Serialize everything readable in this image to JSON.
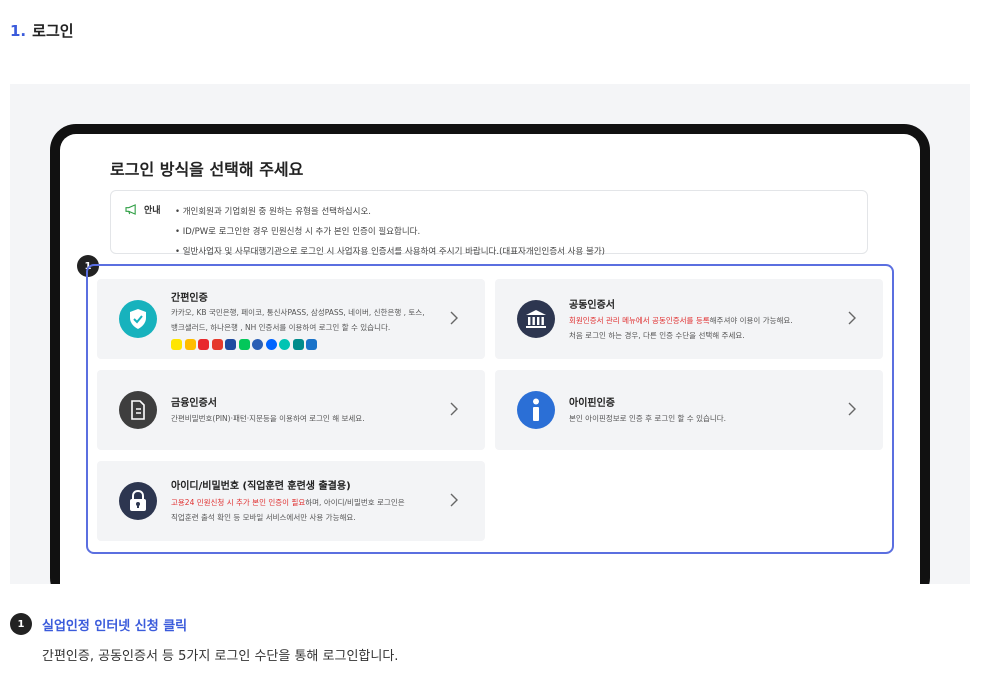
{
  "section": {
    "number": "1.",
    "title": "로그인"
  },
  "screen": {
    "title": "로그인 방식을 선택해 주세요",
    "notice": {
      "label": "안내",
      "items": [
        "개인회원과 기업회원 중 원하는 유형을 선택하십시오.",
        "ID/PW로 로그인한 경우 민원신청 시 추가 본인 인증이 필요합니다.",
        "일반사업자 및 사무대행기관으로 로그인 시 사업자용 인증서를 사용하여 주시기 바랍니다.(대표자개인인증서 사용 불가)"
      ]
    },
    "marker": "1",
    "cards": {
      "simple": {
        "title": "간편인증",
        "desc_line1": "카카오, KB 국민은행, 페이코, 통신사PASS, 삼성PASS, 네이버, 신한은행 , 토스,",
        "desc_line2": "뱅크샐러드, 하나은행 , NH 인증서를 이용하여 로그인 할 수 있습니다."
      },
      "joint": {
        "title": "공동인증서",
        "desc_red": "회원인증서 관리 메뉴에서 공동인증서를 등록",
        "desc_rest": "해주셔야 이용이 가능해요.",
        "desc_line2": "처음 로그인 하는 경우, 다른 인증 수단을 선택해 주세요."
      },
      "finance": {
        "title": "금융인증서",
        "desc": "간편비밀번호(PIN)·패턴·지문등을 이용하여 로그인 해 보세요."
      },
      "ipin": {
        "title": "아이핀인증",
        "desc": "본인 아이핀정보로 인증 후 로그인 할 수 있습니다."
      },
      "idpw": {
        "title": "아이디/비밀번호 (직업훈련 훈련생 출결용)",
        "desc_red": "고용24 민원신청 시 추가 본인 인증이 필요",
        "desc_rest": "하며, 아이디/비밀번호 로그인은",
        "desc_line2": "직업훈련 출석 확인 등 모바일 서비스에서만 사용 가능해요."
      }
    }
  },
  "step": {
    "marker": "1",
    "title": "실업인정 인터넷 신청 클릭",
    "desc": "간편인증, 공동인증서 등 5가지 로그인 수단을 통해 로그인합니다."
  },
  "colors": {
    "accent": "#3b5bdb",
    "highlight": "#5b6fe0",
    "simple_icon": "#17b2bd",
    "dark_icon": "#2d3650",
    "finance_icon": "#3e3e3e",
    "ipin_icon": "#2b6fd6",
    "warning": "#e03131"
  },
  "icons": {
    "notice": "megaphone-icon",
    "simple": "shield-check-icon",
    "joint": "bank-icon",
    "finance": "document-icon",
    "ipin": "info-icon",
    "idpw": "lock-icon",
    "arrow": "chevron-right-icon"
  }
}
